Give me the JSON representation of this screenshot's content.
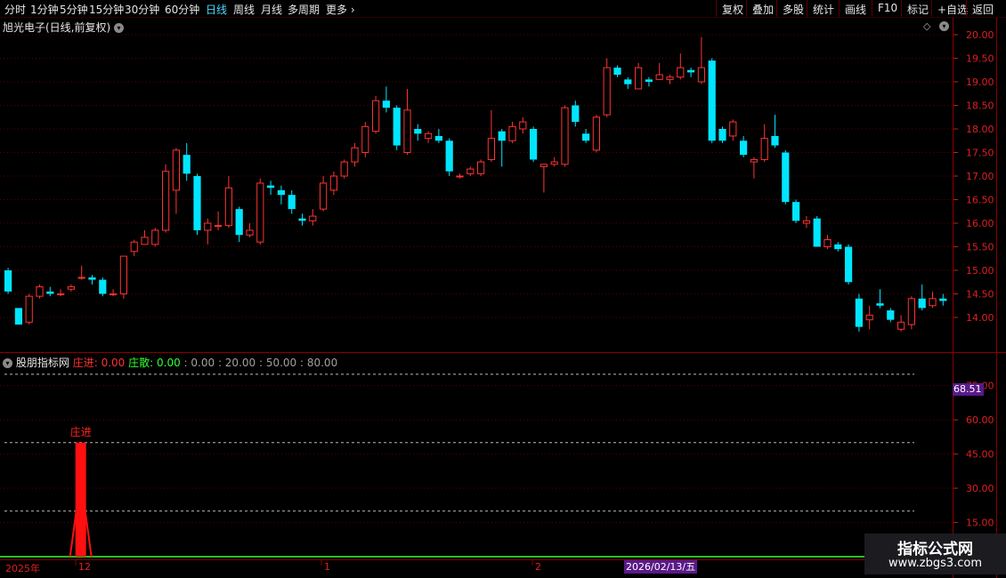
{
  "toolbar": {
    "periods": [
      "分时",
      "1分钟",
      "5分钟",
      "15分钟",
      "30分钟",
      "60分钟",
      "日线",
      "周线",
      "月线",
      "多周期",
      "更多"
    ],
    "active_period": "日线",
    "right_buttons": [
      "复权",
      "叠加",
      "多股",
      "统计",
      "画线",
      "F10",
      "标记",
      "+自选",
      "返回"
    ]
  },
  "chart_title": "旭光电子(日线,前复权)",
  "indicator": {
    "name": "股朋指标网",
    "zj_label": "庄进",
    "zj_value": "0.00",
    "zs_label": "庄散",
    "zs_value": "0.00",
    "params": ": 0.00 : 20.00 : 50.00 : 80.00",
    "signal_label": "庄进",
    "highlight_value": "68.51",
    "y_ticks": [
      "75.00",
      "60.00",
      "45.00",
      "30.00",
      "15.00"
    ]
  },
  "price_axis": {
    "ticks": [
      "20.00",
      "19.50",
      "19.00",
      "18.50",
      "18.00",
      "17.50",
      "17.00",
      "16.50",
      "16.00",
      "15.50",
      "15.00",
      "14.50",
      "14.00"
    ]
  },
  "x_axis": {
    "labels": [
      "2025年",
      "12",
      "1",
      "2"
    ],
    "date_tag": "2026/02/13/五"
  },
  "watermark": {
    "title": "指标公式网",
    "url": "www.zbgs3.com"
  },
  "colors": {
    "up": "#ff3232",
    "down": "#00e5ff",
    "grid": "#5a0000",
    "signal": "#ff1010",
    "baseline": "#30ff30"
  },
  "chart_data": {
    "type": "candlestick",
    "ylim": [
      13.6,
      20.15
    ],
    "candles": [
      [
        15.0,
        14.55,
        15.05,
        14.5
      ],
      [
        14.2,
        13.85,
        14.2,
        13.85
      ],
      [
        13.9,
        14.45,
        14.5,
        13.85
      ],
      [
        14.45,
        14.65,
        14.7,
        14.4
      ],
      [
        14.55,
        14.5,
        14.65,
        14.45
      ],
      [
        14.5,
        14.5,
        14.6,
        14.45
      ],
      [
        14.6,
        14.65,
        14.7,
        14.55
      ],
      [
        14.85,
        14.85,
        15.1,
        14.8
      ],
      [
        14.85,
        14.8,
        14.9,
        14.7
      ],
      [
        14.8,
        14.5,
        14.85,
        14.45
      ],
      [
        14.5,
        14.5,
        14.6,
        14.45
      ],
      [
        14.5,
        15.3,
        15.3,
        14.4
      ],
      [
        15.4,
        15.6,
        15.65,
        15.3
      ],
      [
        15.55,
        15.7,
        15.85,
        15.55
      ],
      [
        15.55,
        15.85,
        15.9,
        15.5
      ],
      [
        15.85,
        17.1,
        17.25,
        15.8
      ],
      [
        16.7,
        17.55,
        17.6,
        16.2
      ],
      [
        17.45,
        17.05,
        17.7,
        16.9
      ],
      [
        17.0,
        15.85,
        17.05,
        15.75
      ],
      [
        15.85,
        16.0,
        16.1,
        15.55
      ],
      [
        15.95,
        15.95,
        16.25,
        15.85
      ],
      [
        15.95,
        16.75,
        17.0,
        15.9
      ],
      [
        16.3,
        15.75,
        16.35,
        15.6
      ],
      [
        15.75,
        15.85,
        16.0,
        15.7
      ],
      [
        15.6,
        16.85,
        16.95,
        15.55
      ],
      [
        16.8,
        16.75,
        16.9,
        16.6
      ],
      [
        16.7,
        16.6,
        16.8,
        16.4
      ],
      [
        16.6,
        16.3,
        16.7,
        16.2
      ],
      [
        16.1,
        16.05,
        16.2,
        15.95
      ],
      [
        16.05,
        16.15,
        16.3,
        15.95
      ],
      [
        16.3,
        16.85,
        17.0,
        16.25
      ],
      [
        16.7,
        17.0,
        17.1,
        16.6
      ],
      [
        17.0,
        17.3,
        17.35,
        16.95
      ],
      [
        17.3,
        17.6,
        17.7,
        17.2
      ],
      [
        17.5,
        18.05,
        18.15,
        17.4
      ],
      [
        17.95,
        18.6,
        18.7,
        17.9
      ],
      [
        18.6,
        18.45,
        18.9,
        18.35
      ],
      [
        18.45,
        17.65,
        18.5,
        17.55
      ],
      [
        17.5,
        18.4,
        18.85,
        17.45
      ],
      [
        18.0,
        17.9,
        18.1,
        17.75
      ],
      [
        17.8,
        17.9,
        17.95,
        17.7
      ],
      [
        17.85,
        17.75,
        18.0,
        17.7
      ],
      [
        17.75,
        17.1,
        17.8,
        17.0
      ],
      [
        17.0,
        17.0,
        17.05,
        16.95
      ],
      [
        17.05,
        17.15,
        17.2,
        17.0
      ],
      [
        17.05,
        17.3,
        17.35,
        17.0
      ],
      [
        17.35,
        17.8,
        18.4,
        17.3
      ],
      [
        17.95,
        17.75,
        18.0,
        17.2
      ],
      [
        17.75,
        18.05,
        18.15,
        17.7
      ],
      [
        18.0,
        18.15,
        18.25,
        17.9
      ],
      [
        18.0,
        17.35,
        18.05,
        17.3
      ],
      [
        17.2,
        17.25,
        17.25,
        16.65
      ],
      [
        17.25,
        17.3,
        17.4,
        17.2
      ],
      [
        17.25,
        18.45,
        18.5,
        17.2
      ],
      [
        18.5,
        18.15,
        18.6,
        18.05
      ],
      [
        17.9,
        17.75,
        18.0,
        17.7
      ],
      [
        17.55,
        18.25,
        18.3,
        17.5
      ],
      [
        18.3,
        19.3,
        19.5,
        18.25
      ],
      [
        19.3,
        19.15,
        19.35,
        19.1
      ],
      [
        19.05,
        18.95,
        19.1,
        18.85
      ],
      [
        18.85,
        19.3,
        19.4,
        18.85
      ],
      [
        19.05,
        19.0,
        19.1,
        18.9
      ],
      [
        19.05,
        19.15,
        19.4,
        19.05
      ],
      [
        19.05,
        19.1,
        19.15,
        18.95
      ],
      [
        19.1,
        19.3,
        19.6,
        19.05
      ],
      [
        19.25,
        19.2,
        19.3,
        19.1
      ],
      [
        19.0,
        19.3,
        19.95,
        18.95
      ],
      [
        19.45,
        17.75,
        19.5,
        17.7
      ],
      [
        18.0,
        17.75,
        18.05,
        17.7
      ],
      [
        17.85,
        18.15,
        18.2,
        17.75
      ],
      [
        17.75,
        17.45,
        17.85,
        17.4
      ],
      [
        17.3,
        17.35,
        17.4,
        16.95
      ],
      [
        17.35,
        17.8,
        18.1,
        17.3
      ],
      [
        17.85,
        17.65,
        18.3,
        17.6
      ],
      [
        17.5,
        16.45,
        17.55,
        16.4
      ],
      [
        16.45,
        16.05,
        16.5,
        16.0
      ],
      [
        16.0,
        16.05,
        16.15,
        15.9
      ],
      [
        16.1,
        15.5,
        16.15,
        15.5
      ],
      [
        15.5,
        15.65,
        15.75,
        15.45
      ],
      [
        15.55,
        15.45,
        15.6,
        15.4
      ],
      [
        15.5,
        14.75,
        15.55,
        14.7
      ],
      [
        14.4,
        13.8,
        14.5,
        13.7
      ],
      [
        13.95,
        14.05,
        14.25,
        13.75
      ],
      [
        14.3,
        14.25,
        14.6,
        14.2
      ],
      [
        14.15,
        13.95,
        14.2,
        13.9
      ],
      [
        13.75,
        13.9,
        14.05,
        13.7
      ],
      [
        13.85,
        14.4,
        14.45,
        13.75
      ],
      [
        14.4,
        14.2,
        14.7,
        14.15
      ],
      [
        14.25,
        14.4,
        14.55,
        14.2
      ],
      [
        14.4,
        14.35,
        14.5,
        14.25
      ]
    ],
    "indicator_levels": [
      80,
      50,
      20
    ],
    "indicator_ylim": [
      0,
      85
    ],
    "signals": [
      {
        "index": 7,
        "value": 50
      }
    ]
  }
}
